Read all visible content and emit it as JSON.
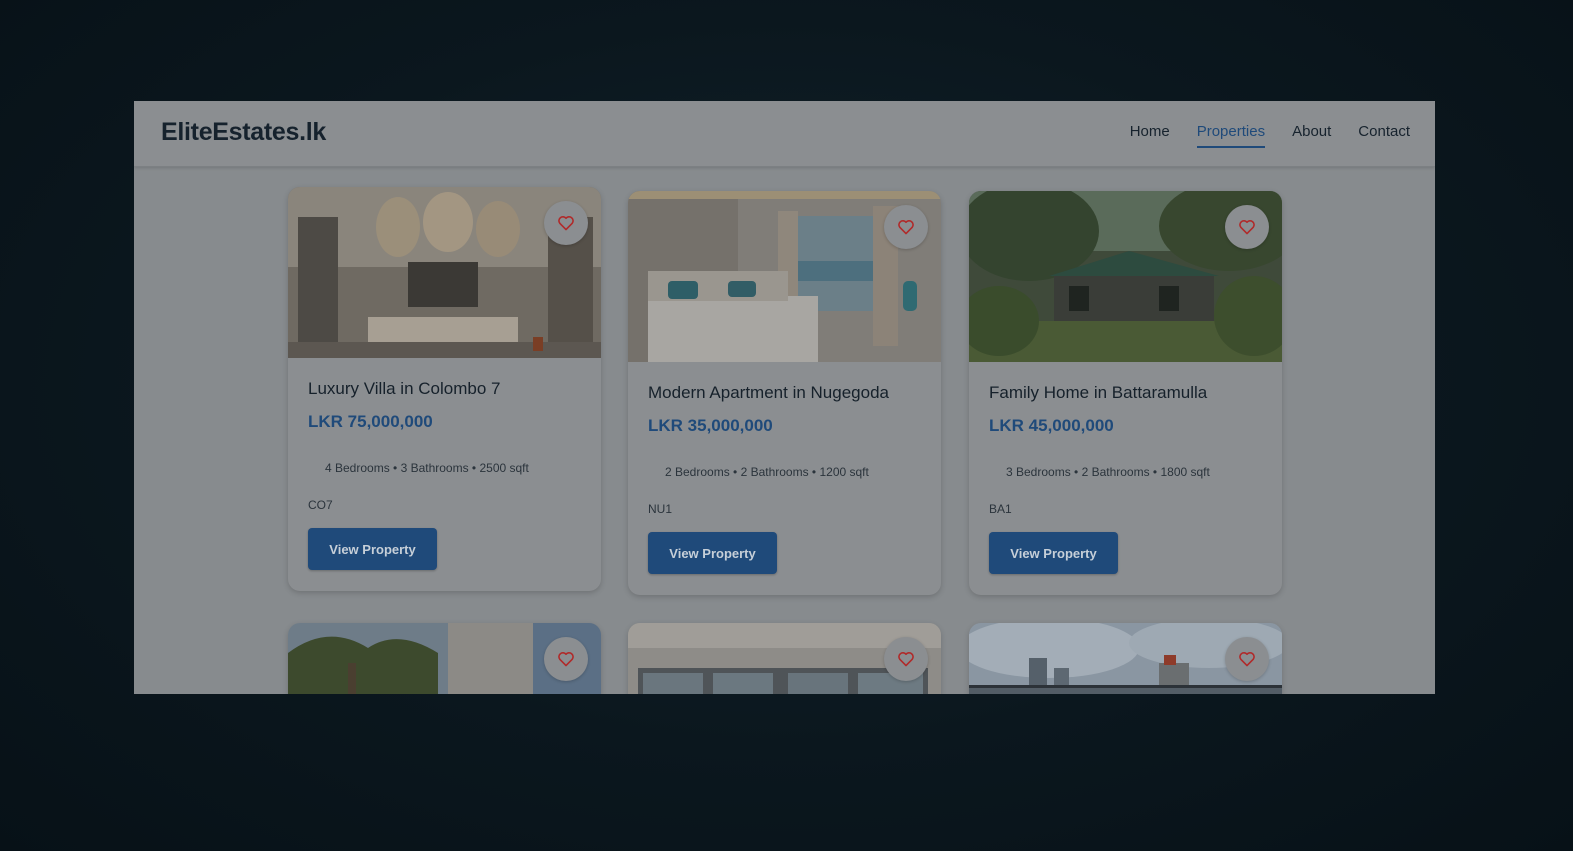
{
  "brand": {
    "logo_text": "EliteEstates.lk"
  },
  "nav": {
    "items": [
      {
        "label": "Home",
        "active": false
      },
      {
        "label": "Properties",
        "active": true
      },
      {
        "label": "About",
        "active": false
      },
      {
        "label": "Contact",
        "active": false
      }
    ]
  },
  "listings": [
    {
      "title": "Luxury Villa in Colombo 7",
      "price": "LKR 75,000,000",
      "specs": "4 Bedrooms • 3 Bathrooms • 2500 sqft",
      "code": "CO7",
      "button_label": "View Property"
    },
    {
      "title": "Modern Apartment in Nugegoda",
      "price": "LKR 35,000,000",
      "specs": "2 Bedrooms • 2 Bathrooms • 1200 sqft",
      "code": "NU1",
      "button_label": "View Property"
    },
    {
      "title": "Family Home in Battaramulla",
      "price": "LKR 45,000,000",
      "specs": "3 Bedrooms • 2 Bathrooms • 1800 sqft",
      "code": "BA1",
      "button_label": "View Property"
    }
  ],
  "icons": {
    "favorite": "heart-outline-icon"
  },
  "colors": {
    "accent": "#1f4a7a",
    "favorite": "#b02a2a",
    "overlay": "#0b171e"
  }
}
